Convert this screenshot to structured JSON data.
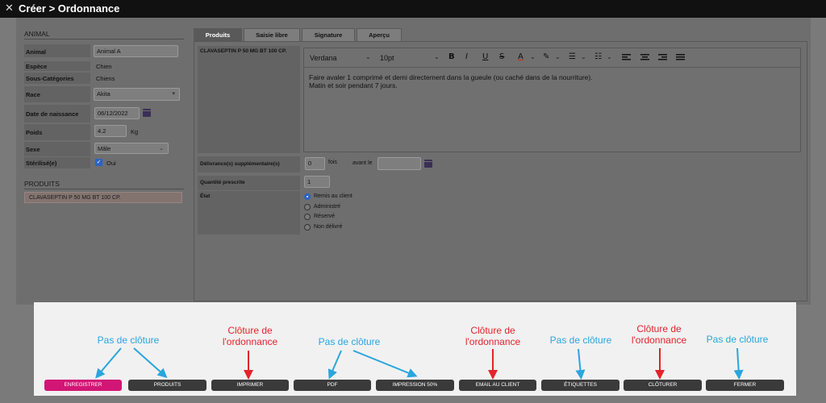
{
  "window": {
    "title": "Créer > Ordonnance",
    "close_icon": "✕"
  },
  "animal_section": {
    "title": "ANIMAL",
    "fields": {
      "animal": {
        "label": "Animal",
        "value": "Animal A"
      },
      "espece": {
        "label": "Espèce",
        "value": "Chien"
      },
      "sous_categories": {
        "label": "Sous-Catégories",
        "value": "Chiens"
      },
      "race": {
        "label": "Race",
        "value": "Akita"
      },
      "date_naissance": {
        "label": "Date de naissance",
        "value": "06/12/2022"
      },
      "poids": {
        "label": "Poids",
        "value": "4.2",
        "unit": "Kg"
      },
      "sexe": {
        "label": "Sexe",
        "value": "Mâle"
      },
      "sterilise": {
        "label": "Stérilisé(e)",
        "value": "Oui",
        "checked": true
      }
    }
  },
  "produits_section": {
    "title": "PRODUITS",
    "items": [
      "CLAVASEPTIN P 50 MG BT 100 CP."
    ]
  },
  "tabs": [
    {
      "label": "Produits",
      "active": true
    },
    {
      "label": "Saisie libre",
      "active": false
    },
    {
      "label": "Signature",
      "active": false
    },
    {
      "label": "Aperçu",
      "active": false
    }
  ],
  "product_form": {
    "product_name": "CLAVASEPTIN P 50 MG BT 100 CP.",
    "editor": {
      "font": "Verdana",
      "size": "10pt",
      "text_line1": "Faire avaler 1 comprimé et demi directement dans la gueule (ou caché dans de la nourriture).",
      "text_line2": "Matin et soir pendant 7 jours."
    },
    "delivrances": {
      "label": "Délivrance(s) supplémentaire(s)",
      "value": "0",
      "unit": "fois",
      "avant_label": "avant le",
      "avant_value": ""
    },
    "quantite": {
      "label": "Quantité prescrite",
      "value": "1"
    },
    "etat": {
      "label": "État",
      "options": [
        "Remis au client",
        "Administré",
        "Réservé",
        "Non délivré"
      ],
      "selected_index": 0
    }
  },
  "footer_buttons": [
    "ENREGISTRER",
    "PRODUITS",
    "IMPRIMER",
    "PDF",
    "IMPRESSION 50%",
    "EMAIL AU CLIENT",
    "ÉTIQUETTES",
    "CLÔTURER",
    "FERMER"
  ],
  "annotations": [
    {
      "line1": "Pas de clôture",
      "line2": "",
      "color": "#2aa5dc"
    },
    {
      "line1": "Clôture de",
      "line2": "l'ordonnance",
      "color": "#e3232b"
    },
    {
      "line1": "Pas de clôture",
      "line2": "",
      "color": "#2aa5dc"
    },
    {
      "line1": "Clôture de",
      "line2": "l'ordonnance",
      "color": "#e3232b"
    },
    {
      "line1": "Pas de clôture",
      "line2": "",
      "color": "#2aa5dc"
    },
    {
      "line1": "Clôture de",
      "line2": "l'ordonnance",
      "color": "#e3232b"
    },
    {
      "line1": "Pas de clôture",
      "line2": "",
      "color": "#2aa5dc"
    }
  ],
  "colors": {
    "primary_button": "#d21675",
    "annotation_blue": "#2aa5dc",
    "annotation_red": "#e3232b"
  }
}
